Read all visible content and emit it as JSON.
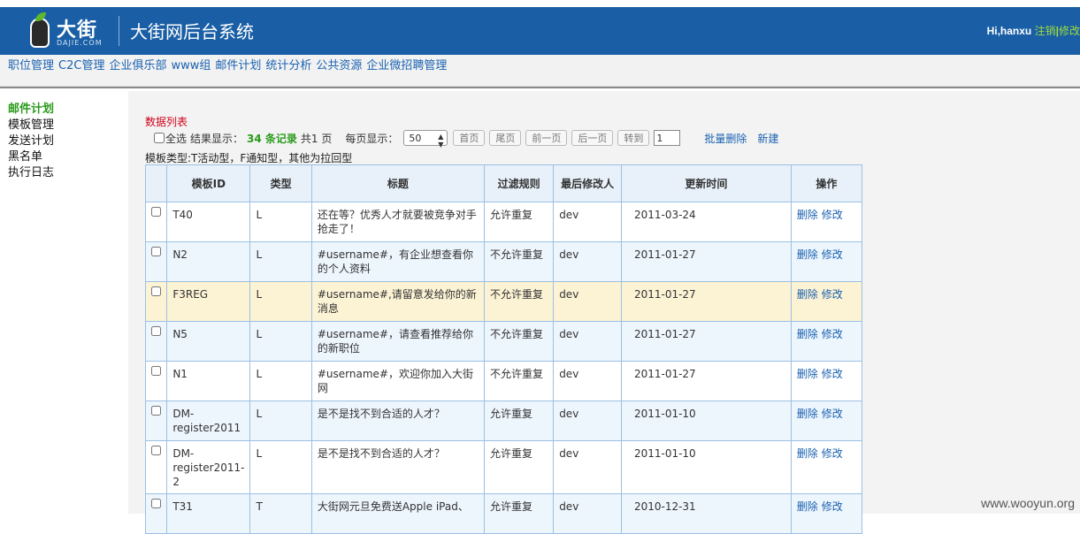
{
  "header": {
    "logo_text": "大街",
    "logo_sub": "DAJIE.COM",
    "system_title": "大街网后台系统",
    "greeting": "Hi,hanxu",
    "logout_label": "注销",
    "separator": "|",
    "modify_label": "修改"
  },
  "nav": [
    "职位管理",
    "C2C管理",
    "企业俱乐部",
    "www组",
    "邮件计划",
    "统计分析",
    "公共资源",
    "企业微招聘管理"
  ],
  "sidebar": [
    "邮件计划",
    "模板管理",
    "发送计划",
    "黑名单",
    "执行日志"
  ],
  "list": {
    "title": "数据列表",
    "select_all": "全选",
    "result_label": "结果显示：",
    "count": "34 条记录",
    "pages": "共1 页",
    "per_page_label": "每页显示：",
    "per_page_value": "50",
    "btn_first": "首页",
    "btn_last": "尾页",
    "btn_prev": "前一页",
    "btn_next": "后一页",
    "btn_goto": "转到",
    "goto_value": "1",
    "batch_delete": "批量删除",
    "create": "新建",
    "type_note": "模板类型:T活动型，F通知型，其他为拉回型"
  },
  "table": {
    "headers": [
      "模板ID",
      "类型",
      "标题",
      "过滤规则",
      "最后修改人",
      "更新时间",
      "操作"
    ],
    "delete_label": "删除",
    "edit_label": "修改",
    "rows": [
      {
        "id": "T40",
        "type": "L",
        "title": "还在等？优秀人才就要被竞争对手抢走了！",
        "rule": "允许重复",
        "user": "dev",
        "time": "2011-03-24"
      },
      {
        "id": "N2",
        "type": "L",
        "title": "#username#，有企业想查看你的个人资料",
        "rule": "不允许重复",
        "user": "dev",
        "time": "2011-01-27"
      },
      {
        "id": "F3REG",
        "type": "L",
        "title": "#username#,请留意发给你的新消息",
        "rule": "不允许重复",
        "user": "dev",
        "time": "2011-01-27"
      },
      {
        "id": "N5",
        "type": "L",
        "title": "#username#，请查看推荐给你的新职位",
        "rule": "不允许重复",
        "user": "dev",
        "time": "2011-01-27"
      },
      {
        "id": "N1",
        "type": "L",
        "title": "#username#，欢迎你加入大街网",
        "rule": "不允许重复",
        "user": "dev",
        "time": "2011-01-27"
      },
      {
        "id": "DM-register2011",
        "type": "L",
        "title": "是不是找不到合适的人才？",
        "rule": "允许重复",
        "user": "dev",
        "time": "2011-01-10"
      },
      {
        "id": "DM-register2011-2",
        "type": "L",
        "title": "是不是找不到合适的人才？",
        "rule": "允许重复",
        "user": "dev",
        "time": "2011-01-10"
      },
      {
        "id": "T31",
        "type": "T",
        "title": "大街网元旦免费送Apple iPad、",
        "rule": "允许重复",
        "user": "dev",
        "time": "2010-12-31"
      }
    ]
  },
  "watermark": "www.wooyun.org"
}
